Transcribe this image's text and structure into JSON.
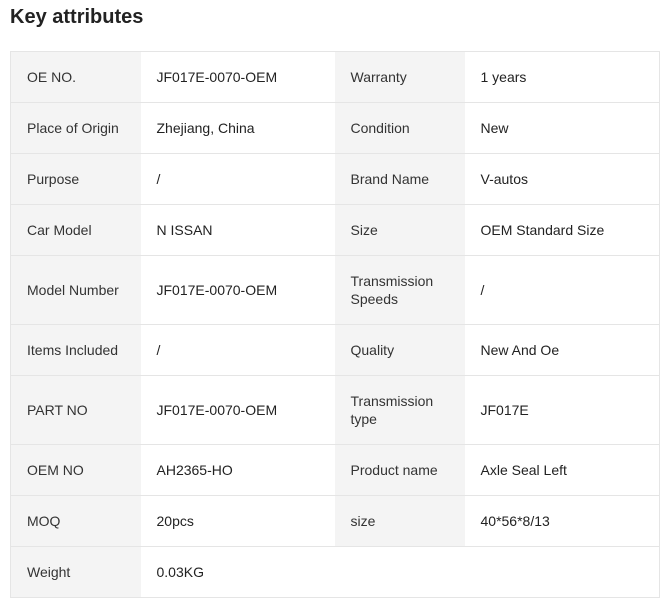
{
  "section": {
    "title": "Key attributes"
  },
  "rows": [
    {
      "l1": "OE NO.",
      "v1": "JF017E-0070-OEM",
      "l2": "Warranty",
      "v2": "1 years"
    },
    {
      "l1": "Place of Origin",
      "v1": "Zhejiang, China",
      "l2": "Condition",
      "v2": "New"
    },
    {
      "l1": "Purpose",
      "v1": "/",
      "l2": "Brand Name",
      "v2": "V-autos"
    },
    {
      "l1": "Car Model",
      "v1": "N ISSAN",
      "l2": "Size",
      "v2": "OEM Standard Size"
    },
    {
      "l1": "Model Number",
      "v1": "JF017E-0070-OEM",
      "l2": "Transmission Speeds",
      "v2": "/"
    },
    {
      "l1": "Items Included",
      "v1": "/",
      "l2": "Quality",
      "v2": "New And Oe"
    },
    {
      "l1": "PART NO",
      "v1": "JF017E-0070-OEM",
      "l2": "Transmission type",
      "v2": "JF017E"
    },
    {
      "l1": "OEM NO",
      "v1": "AH2365-HO",
      "l2": "Product name",
      "v2": "Axle Seal Left"
    },
    {
      "l1": "MOQ",
      "v1": "20pcs",
      "l2": "size",
      "v2": "40*56*8/13"
    },
    {
      "l1": "Weight",
      "v1": "0.03KG",
      "l2": "",
      "v2": ""
    }
  ]
}
